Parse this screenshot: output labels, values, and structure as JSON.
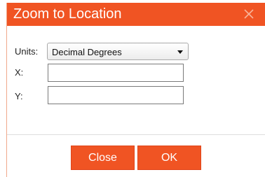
{
  "dialog": {
    "title": "Zoom to Location",
    "close_icon": "close-icon"
  },
  "form": {
    "units_label": "Units:",
    "units_value": "Decimal Degrees",
    "x_label": "X:",
    "x_value": "",
    "y_label": "Y:",
    "y_value": ""
  },
  "buttons": {
    "close_label": "Close",
    "ok_label": "OK"
  },
  "colors": {
    "accent": "#f05423",
    "text": "#222222"
  }
}
